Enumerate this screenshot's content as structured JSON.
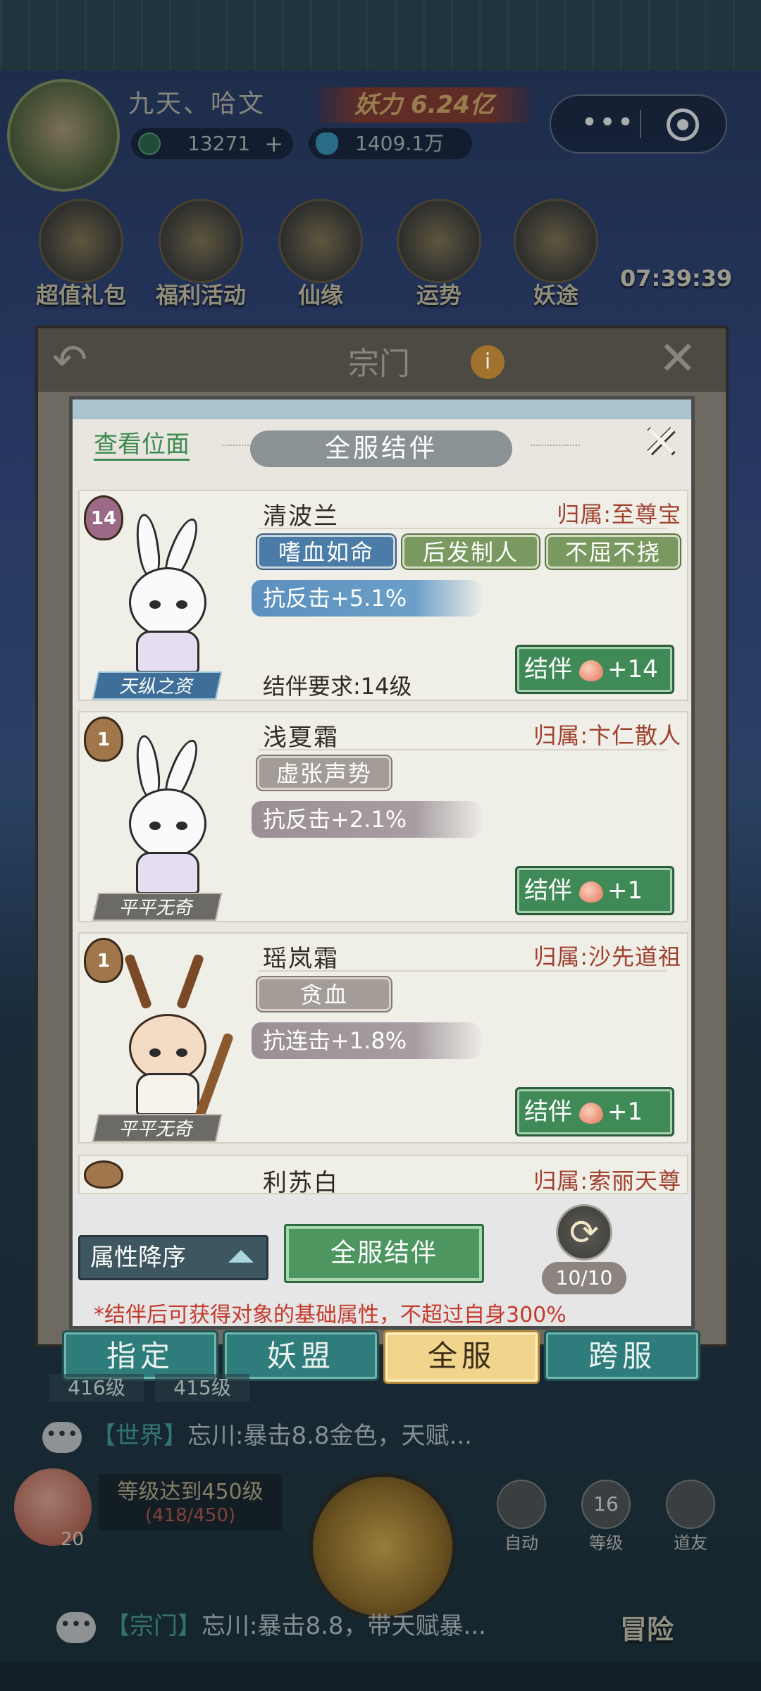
{
  "hud": {
    "player_name": "九天、哈文",
    "power": "妖力 6.24亿",
    "coins": "13271",
    "gems": "1409.1万",
    "icons": [
      {
        "label": "超值礼包"
      },
      {
        "label": "福利活动"
      },
      {
        "label": "仙缘"
      },
      {
        "label": "运势"
      },
      {
        "label": "妖途"
      }
    ],
    "timer": "07:39:39"
  },
  "sect": {
    "title": "宗门",
    "info": "i"
  },
  "dialog": {
    "view_link": "查看位面",
    "title": "全服结伴",
    "close": "✕"
  },
  "cards": [
    {
      "level": "14",
      "name": "清波兰",
      "belong": "归属:至尊宝",
      "tags": [
        "嗜血如命",
        "后发制人",
        "不屈不挠"
      ],
      "stat": "抗反击+5.1%",
      "talent": "天纵之资",
      "requirement": "结伴要求:14级",
      "button": "结伴",
      "button_value": "+14"
    },
    {
      "level": "1",
      "name": "浅夏霜",
      "belong": "归属:卞仁散人",
      "tags": [
        "虚张声势"
      ],
      "stat": "抗反击+2.1%",
      "talent": "平平无奇",
      "button": "结伴",
      "button_value": "+1"
    },
    {
      "level": "1",
      "name": "瑶岚霜",
      "belong": "归属:沙先道祖",
      "tags": [
        "贪血"
      ],
      "stat": "抗连击+1.8%",
      "talent": "平平无奇",
      "button": "结伴",
      "button_value": "+1"
    },
    {
      "name": "利苏白",
      "belong": "归属:索丽天尊"
    }
  ],
  "bottom": {
    "sort_label": "属性降序",
    "all_partner": "全服结伴",
    "refresh_count": "10/10",
    "note": "*结伴后可获得对象的基础属性，不超过自身300%"
  },
  "tabs": [
    "指定",
    "妖盟",
    "全服",
    "跨服"
  ],
  "under_tabs": [
    "416级",
    "415级"
  ],
  "world_chat": {
    "tag": "【世界】",
    "text": "忘川:暴击8.8金色，天赋..."
  },
  "level_goal": {
    "line1": "等级达到450级",
    "line2": "(418/450)",
    "peach_count": "20"
  },
  "mini_icons": [
    "自动",
    "等级",
    "道友"
  ],
  "mini_badge": "16",
  "sect_chat": {
    "tag": "【宗门】",
    "text": "忘川:暴击8.8，带天赋暴..."
  },
  "adventure": "冒险"
}
